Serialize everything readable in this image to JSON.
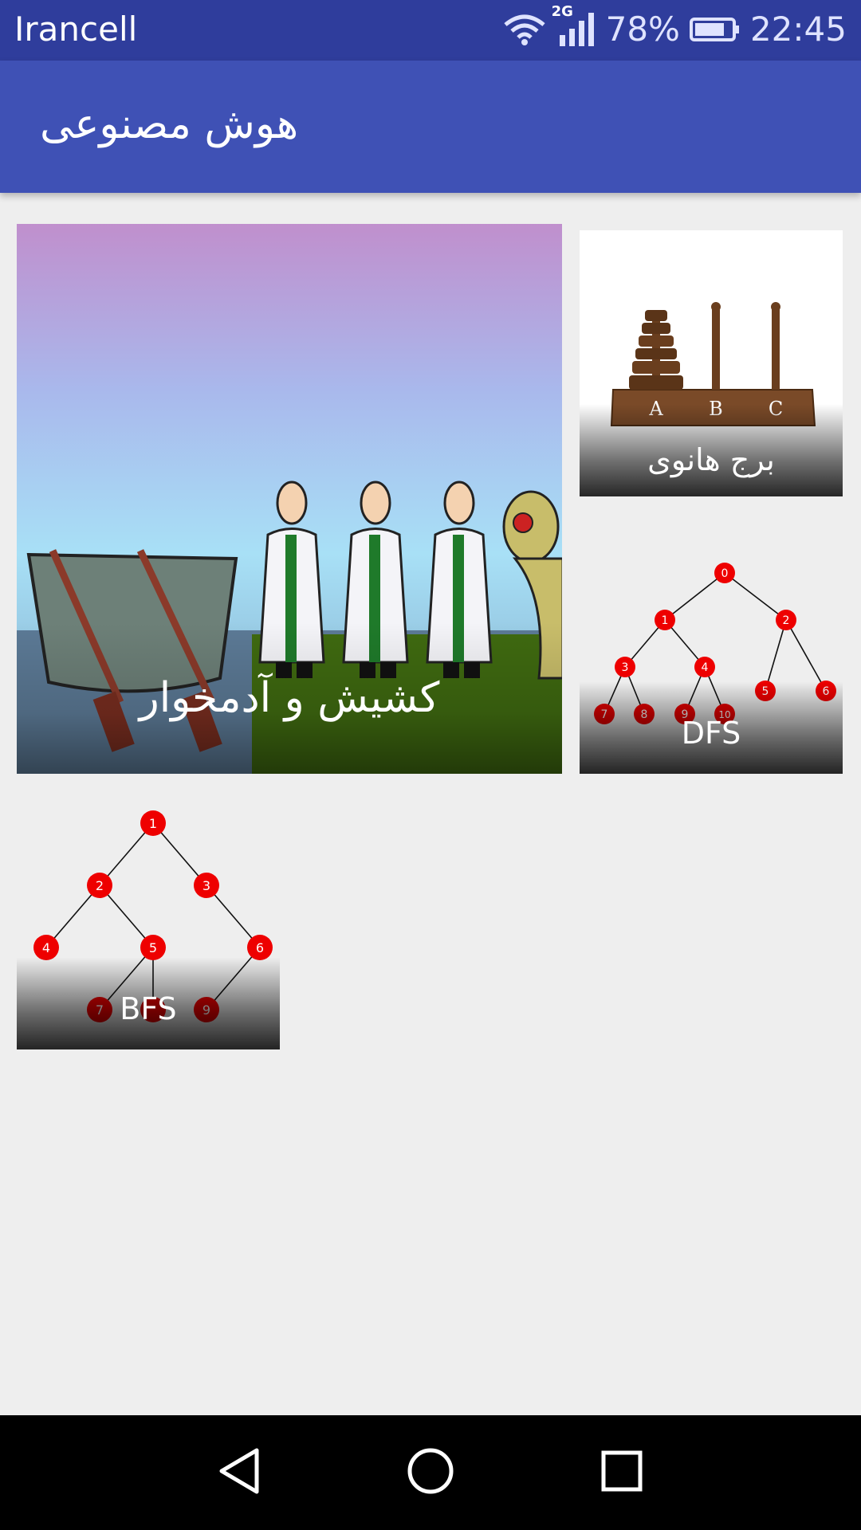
{
  "status_bar": {
    "carrier": "Irancell",
    "network": "2G",
    "battery": "78%",
    "time": "22:45"
  },
  "app_bar": {
    "title": "هوش مصنوعی"
  },
  "tiles": [
    {
      "caption": "کشیش و آدمخوار"
    },
    {
      "caption": "برج هانوی",
      "tower_labels": [
        "A",
        "B",
        "C"
      ]
    },
    {
      "caption": "DFS",
      "nodes": [
        "0",
        "1",
        "2",
        "3",
        "4",
        "5",
        "6",
        "7",
        "8",
        "9",
        "10"
      ]
    },
    {
      "caption": "BFS",
      "nodes": [
        "1",
        "2",
        "3",
        "4",
        "5",
        "6",
        "7",
        "9"
      ]
    }
  ],
  "colors": {
    "status_bar": "#2f3d9c",
    "app_bar": "#3f51b5",
    "background": "#eeeeee",
    "node_red": "#ee0000"
  },
  "nav_bar": {
    "icons": [
      "back-icon",
      "home-icon",
      "recents-icon"
    ]
  }
}
